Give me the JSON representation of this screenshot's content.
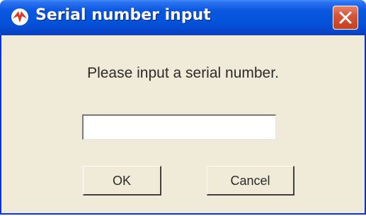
{
  "window": {
    "title": "Serial number input",
    "title_icon": "app-logo-icon",
    "close_icon": "close-icon",
    "accent_color": "#0553dc",
    "close_color": "#d5563a"
  },
  "dialog": {
    "prompt": "Please input a serial number.",
    "serial_input": {
      "value": "",
      "placeholder": ""
    },
    "ok_label": "OK",
    "cancel_label": "Cancel"
  }
}
